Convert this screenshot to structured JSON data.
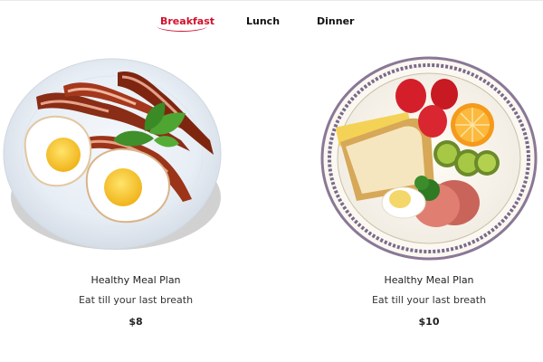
{
  "nav": {
    "tabs": [
      {
        "label": "Breakfast",
        "active": true
      },
      {
        "label": "Lunch",
        "active": false
      },
      {
        "label": "Dinner",
        "active": false
      }
    ],
    "accent_color": "#d1102b"
  },
  "menu": [
    {
      "title": "Healthy Meal Plan",
      "subtitle": "Eat till your last breath",
      "price": "$8",
      "image": "bacon-and-eggs-plate"
    },
    {
      "title": "Healthy Meal Plan",
      "subtitle": "Eat till your last breath",
      "price": "$10",
      "image": "toast-fruit-plate"
    }
  ]
}
